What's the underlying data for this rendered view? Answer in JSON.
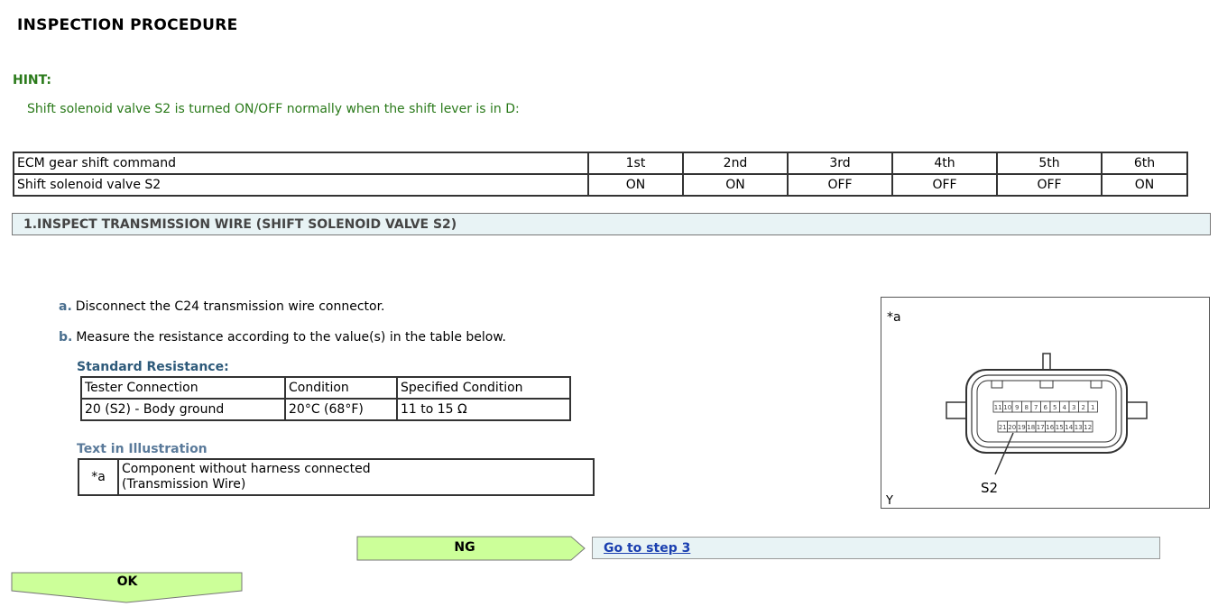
{
  "title": "INSPECTION PROCEDURE",
  "hint": {
    "label": "HINT:",
    "text": "Shift solenoid valve S2 is turned ON/OFF normally when the shift lever is in D:"
  },
  "gear_table": {
    "rows": [
      [
        "ECM gear shift command",
        "1st",
        "2nd",
        "3rd",
        "4th",
        "5th",
        "6th"
      ],
      [
        "Shift solenoid valve S2",
        "ON",
        "ON",
        "OFF",
        "OFF",
        "OFF",
        "ON"
      ]
    ]
  },
  "step": {
    "title": "1.INSPECT TRANSMISSION WIRE (SHIFT SOLENOID VALVE S2)",
    "items": [
      {
        "marker": "a.",
        "text": "Disconnect the C24 transmission wire connector."
      },
      {
        "marker": "b.",
        "text": "Measure the resistance according to the value(s) in the table below."
      }
    ],
    "standard_resistance": {
      "label": "Standard Resistance:",
      "headers": [
        "Tester Connection",
        "Condition",
        "Specified Condition"
      ],
      "rows": [
        [
          "20 (S2) - Body ground",
          "20°C (68°F)",
          "11 to 15 Ω"
        ]
      ]
    },
    "text_in_illustration": {
      "label": "Text in Illustration",
      "rows": [
        [
          "*a",
          "Component without harness connected",
          "(Transmission Wire)"
        ]
      ]
    }
  },
  "illustration": {
    "tag": "*a",
    "pin_label": "S2",
    "corner_label": "Y",
    "top_row_pins": [
      "11",
      "10",
      "9",
      "8",
      "7",
      "6",
      "5",
      "4",
      "3",
      "2",
      "1"
    ],
    "bottom_row_pins": [
      "21",
      "20",
      "19",
      "18",
      "17",
      "16",
      "15",
      "14",
      "13",
      "12"
    ]
  },
  "navigation": {
    "ng_label": "NG",
    "ng_link": "Go to step 3",
    "ok_label": "OK"
  },
  "colors": {
    "hint_green": "#2a7a1a",
    "button_green": "#ccff99",
    "bar_bg": "#e8f3f5",
    "link_blue": "#1a3fb0"
  }
}
